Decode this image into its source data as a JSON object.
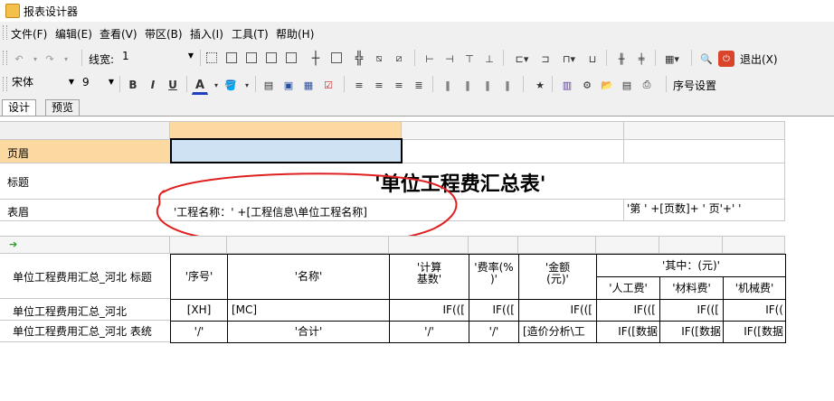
{
  "window": {
    "title": "报表设计器"
  },
  "menu": [
    "文件(F)",
    "编辑(E)",
    "查看(V)",
    "带区(B)",
    "插入(I)",
    "工具(T)",
    "帮助(H)"
  ],
  "toolbar1": {
    "linewidth_label": "线宽:",
    "linewidth_value": "1",
    "exit_label": "退出(X)"
  },
  "toolbar2": {
    "font_name": "宋体",
    "font_size": "9",
    "bold": "B",
    "italic": "I",
    "underline": "U",
    "font_color": "A",
    "seq_label": "序号设置"
  },
  "tabs": [
    "设计",
    "预览"
  ],
  "bands": {
    "page_header": "页眉",
    "title": "标题",
    "table_header": "表眉",
    "group1": "单位工程费用汇总_河北 标题",
    "detail": "单位工程费用汇总_河北",
    "footer": "单位工程费用汇总_河北 表统"
  },
  "report": {
    "title_text": "'单位工程费汇总表'",
    "project_name_expr": "'工程名称：' +[工程信息\\单位工程名称]",
    "page_expr": "'第 ' +[页数]+ ' 页'+' '",
    "columns": {
      "seq": "'序号'",
      "name": "'名称'",
      "base_l1": "'计算",
      "base_l2": "基数'",
      "rate_l1": "'费率(%",
      "rate_l2": ")'",
      "amount_l1": "'金额",
      "amount_l2": "(元)'",
      "of_which": "'其中：(元)'",
      "labor": "'人工费'",
      "material": "'材料费'",
      "machine": "'机械费'"
    },
    "detail_row": [
      "[XH]",
      "[MC]",
      "IF(([",
      "IF(([",
      "IF(([",
      "IF(([",
      "IF(([",
      "IF(("
    ],
    "total_row": [
      "'/'",
      "'合计'",
      "'/'",
      "'/'",
      "[造价分析\\工",
      "IF([数据",
      "IF([数据",
      "IF([数据"
    ]
  }
}
